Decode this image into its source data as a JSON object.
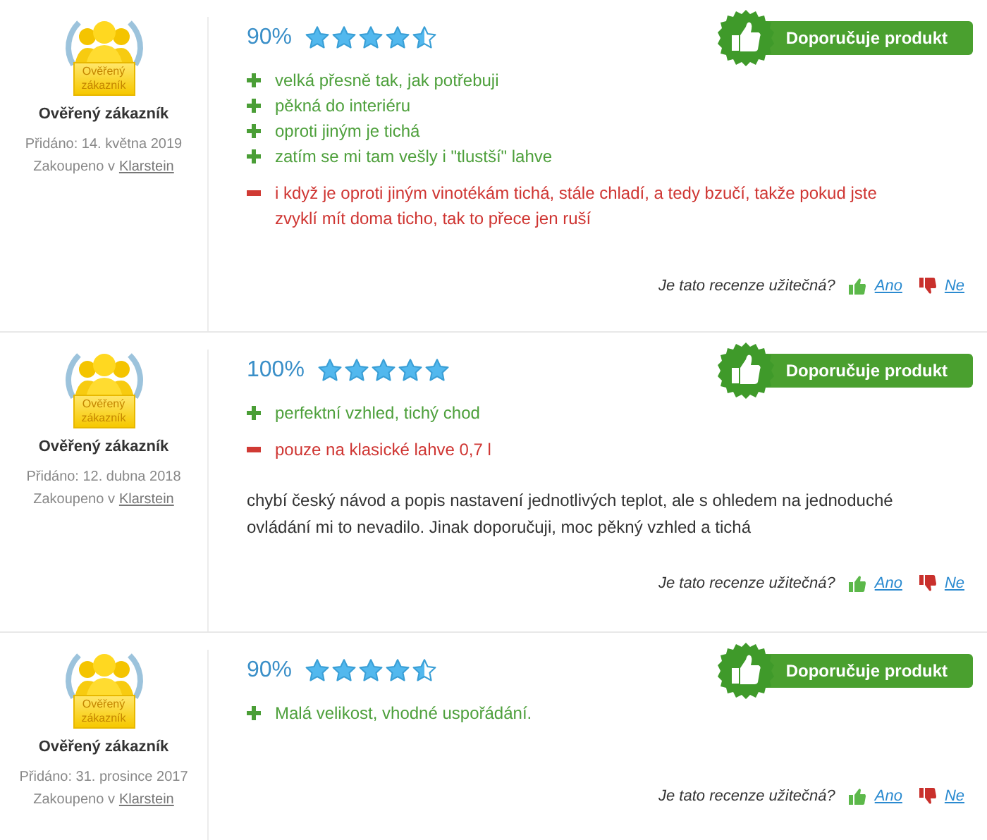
{
  "reviews": [
    {
      "badge_text": "Ověřený zákazník",
      "author": "Ověřený zákazník",
      "added": "Přidáno: 14. května 2019",
      "purchased_prefix": "Zakoupeno v",
      "shop": "Klarstein",
      "score": "90%",
      "stars": 4.5,
      "recommended": true,
      "recommend_label": "Doporučuje produkt",
      "points": [
        {
          "kind": "pro",
          "text": "velká přesně tak, jak potřebuji"
        },
        {
          "kind": "pro",
          "text": "pěkná do interiéru"
        },
        {
          "kind": "pro",
          "text": "oproti jiným je tichá"
        },
        {
          "kind": "pro",
          "text": "zatím se mi tam vešly i \"tlustší\" lahve"
        },
        {
          "kind": "con",
          "text": "i když je oproti jiným vinotékám tichá, stále chladí, a tedy bzučí, takže pokud jste zvyklí mít doma ticho, tak to přece jen ruší"
        }
      ],
      "helpful_question": "Je tato recenze užitečná?",
      "yes": "Ano",
      "no": "Ne"
    },
    {
      "badge_text": "Ověřený zákazník",
      "author": "Ověřený zákazník",
      "added": "Přidáno: 12. dubna 2018",
      "purchased_prefix": "Zakoupeno v",
      "shop": "Klarstein",
      "score": "100%",
      "stars": 5,
      "recommended": true,
      "recommend_label": "Doporučuje produkt",
      "points": [
        {
          "kind": "pro",
          "text": "perfektní vzhled, tichý chod"
        },
        {
          "kind": "con",
          "text": "pouze na klasické lahve 0,7 l"
        }
      ],
      "comment": "chybí český návod a popis nastavení jednotlivých teplot, ale s ohledem na jednoduché ovládání mi to nevadilo. Jinak doporučuji, moc pěkný vzhled a tichá",
      "helpful_question": "Je tato recenze užitečná?",
      "yes": "Ano",
      "no": "Ne"
    },
    {
      "badge_text": "Ověřený zákazník",
      "author": "Ověřený zákazník",
      "added": "Přidáno: 31. prosince 2017",
      "purchased_prefix": "Zakoupeno v",
      "shop": "Klarstein",
      "score": "90%",
      "stars": 4.5,
      "recommended": true,
      "recommend_label": "Doporučuje produkt",
      "points": [
        {
          "kind": "pro",
          "text": "Malá velikost, vhodné uspořádání."
        }
      ],
      "helpful_question": "Je tato recenze užitečná?",
      "yes": "Ano",
      "no": "Ne"
    }
  ]
}
